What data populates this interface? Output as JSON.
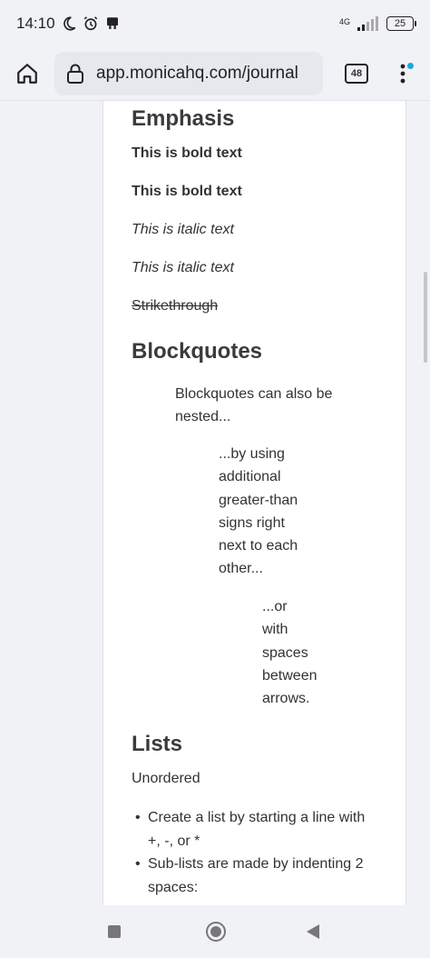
{
  "status_bar": {
    "time": "14:10",
    "network_type": "4G",
    "battery": "25"
  },
  "browser": {
    "url": "app.monicahq.com/journal",
    "tab_count": "48"
  },
  "content": {
    "emphasis_heading": "Emphasis",
    "bold_1": "This is bold text",
    "bold_2": "This is bold text",
    "italic_1": "This is italic text",
    "italic_2": "This is italic text",
    "strikethrough": "Strikethrough",
    "blockquotes_heading": "Blockquotes",
    "quote_level1_line1": "Blockquotes can also be",
    "quote_level1_line2": "nested...",
    "quote_level2": [
      "...by using",
      "additional",
      "greater-than",
      "signs right",
      "next to each",
      "other..."
    ],
    "quote_level3": [
      "...or",
      "with",
      "spaces",
      "between",
      "arrows."
    ],
    "lists_heading": "Lists",
    "unordered_label": "Unordered",
    "list_items": [
      [
        "Create a list by starting a line with",
        "+, -, or *"
      ],
      [
        "Sub-lists are made by indenting 2",
        "spaces:"
      ]
    ]
  },
  "icons": {
    "home": "home-icon",
    "lock": "lock-icon",
    "menu": "more-vertical-icon",
    "dnd": "moon-icon",
    "alarm": "alarm-icon",
    "app": "notification-icon"
  },
  "colors": {
    "background": "#f1f2f6",
    "card": "#ffffff",
    "text": "#333333",
    "accent_dot": "#1aa7e8"
  }
}
